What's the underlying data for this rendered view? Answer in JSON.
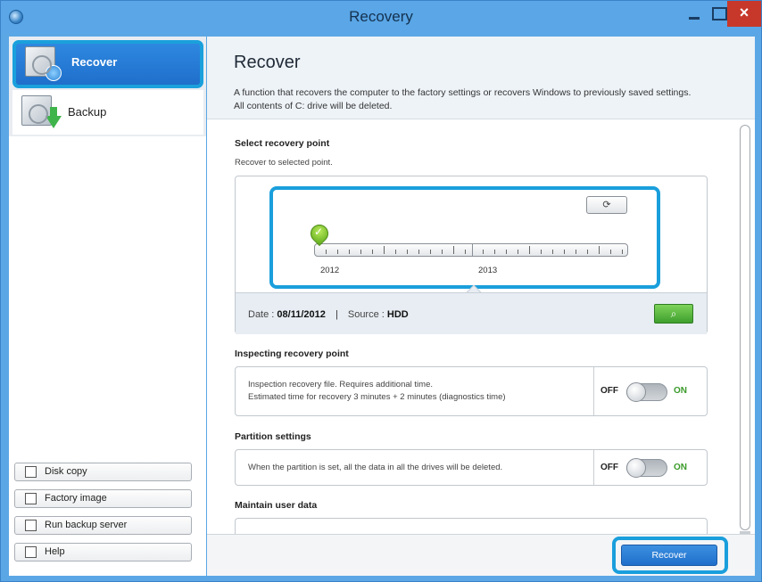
{
  "window": {
    "title": "Recovery",
    "close_glyph": "×"
  },
  "sidebar": {
    "nav": [
      {
        "label": "Recover",
        "icon": "drive-recover-icon",
        "selected": true
      },
      {
        "label": "Backup",
        "icon": "drive-backup-icon",
        "selected": false
      }
    ],
    "buttons": [
      {
        "label": "Disk copy",
        "icon": "disk-copy-icon"
      },
      {
        "label": "Factory image",
        "icon": "factory-image-icon"
      },
      {
        "label": "Run backup server",
        "icon": "backup-server-icon"
      },
      {
        "label": "Help",
        "icon": "help-icon"
      }
    ]
  },
  "main": {
    "title": "Recover",
    "description_line1": "A function that recovers the computer to the factory settings or recovers Windows to previously saved settings.",
    "description_line2": "All contents of C: drive will be deleted.",
    "recovery_point": {
      "title": "Select recovery point",
      "subtitle": "Recover to selected point.",
      "years": [
        "2012",
        "2013"
      ],
      "date_label": "Date :",
      "date_value": "08/11/2012",
      "source_label": "Source :",
      "source_value": "HDD",
      "separator": "|"
    },
    "inspecting": {
      "title": "Inspecting recovery point",
      "line1": "Inspection recovery file. Requires additional time.",
      "line2": "Estimated time for recovery 3 minutes + 2 minutes (diagnostics time)",
      "off": "OFF",
      "on": "ON"
    },
    "partition": {
      "title": "Partition settings",
      "text": "When the partition is set, all the data in all the drives will be deleted.",
      "off": "OFF",
      "on": "ON"
    },
    "maintain": {
      "title": "Maintain user data"
    },
    "recover_button": "Recover"
  },
  "colors": {
    "accent": "#1a9fdc",
    "titlebar": "#5aa6e6",
    "close": "#c7382a",
    "on_green": "#3a9b2a"
  }
}
